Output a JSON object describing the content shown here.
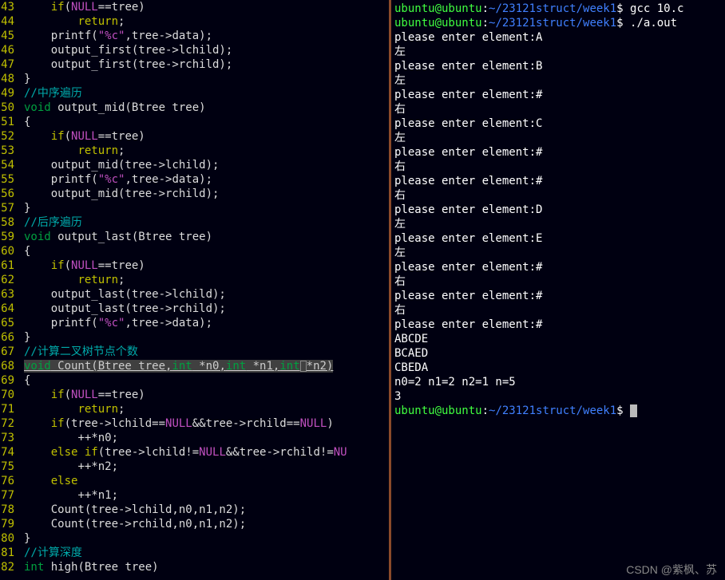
{
  "editor": {
    "lines": [
      {
        "n": 43,
        "html": "    <span class='kw'>if</span><span class='plain'>(</span><span class='const'>NULL</span><span class='plain'>==tree)</span>"
      },
      {
        "n": 44,
        "html": "        <span class='kw'>return</span><span class='plain'>;</span>"
      },
      {
        "n": 45,
        "html": "    <span class='plain'>printf(</span><span class='str'>\"%c\"</span><span class='plain'>,tree-&gt;data);</span>"
      },
      {
        "n": 46,
        "html": "    <span class='plain'>output_first(tree-&gt;lchild);</span>"
      },
      {
        "n": 47,
        "html": "    <span class='plain'>output_first(tree-&gt;rchild);</span>"
      },
      {
        "n": 48,
        "html": "<span class='plain'>}</span>"
      },
      {
        "n": 49,
        "html": "<span class='comment'>//中序遍历</span>"
      },
      {
        "n": 50,
        "html": "<span class='type'>void</span><span class='plain'> output_mid(Btree tree)</span>"
      },
      {
        "n": 51,
        "html": "<span class='plain'>{</span>"
      },
      {
        "n": 52,
        "html": "    <span class='kw'>if</span><span class='plain'>(</span><span class='const'>NULL</span><span class='plain'>==tree)</span>"
      },
      {
        "n": 53,
        "html": "        <span class='kw'>return</span><span class='plain'>;</span>"
      },
      {
        "n": 54,
        "html": "    <span class='plain'>output_mid(tree-&gt;lchild);</span>"
      },
      {
        "n": 55,
        "html": "    <span class='plain'>printf(</span><span class='str'>\"%c\"</span><span class='plain'>,tree-&gt;data);</span>"
      },
      {
        "n": 56,
        "html": "    <span class='plain'>output_mid(tree-&gt;rchild);</span>"
      },
      {
        "n": 57,
        "html": "<span class='plain'>}</span>"
      },
      {
        "n": 58,
        "html": "<span class='comment'>//后序遍历</span>"
      },
      {
        "n": 59,
        "html": "<span class='type'>void</span><span class='plain'> output_last(Btree tree)</span>"
      },
      {
        "n": 60,
        "html": "<span class='plain'>{</span>"
      },
      {
        "n": 61,
        "html": "    <span class='kw'>if</span><span class='plain'>(</span><span class='const'>NULL</span><span class='plain'>==tree)</span>"
      },
      {
        "n": 62,
        "html": "        <span class='kw'>return</span><span class='plain'>;</span>"
      },
      {
        "n": 63,
        "html": "    <span class='plain'>output_last(tree-&gt;lchild);</span>"
      },
      {
        "n": 64,
        "html": "    <span class='plain'>output_last(tree-&gt;rchild);</span>"
      },
      {
        "n": 65,
        "html": "    <span class='plain'>printf(</span><span class='str'>\"%c\"</span><span class='plain'>,tree-&gt;data);</span>"
      },
      {
        "n": 66,
        "html": "<span class='plain'>}</span>"
      },
      {
        "n": 67,
        "html": "<span class='comment'>//计算二叉树节点个数</span>"
      },
      {
        "n": 68,
        "hl": true,
        "html": "<span class='hl'><span class='type'>void</span> Count(Btree tree,<span class='type'>int</span> *n0,<span class='type'>int</span> *n1,<span class='type'>int</span><span class='cursorbox'></span>*n2)</span>"
      },
      {
        "n": 69,
        "html": "<span class='plain'>{</span>"
      },
      {
        "n": 70,
        "html": "    <span class='kw'>if</span><span class='plain'>(</span><span class='const'>NULL</span><span class='plain'>==tree)</span>"
      },
      {
        "n": 71,
        "html": "        <span class='kw'>return</span><span class='plain'>;</span>"
      },
      {
        "n": 72,
        "html": "    <span class='kw'>if</span><span class='plain'>(tree-&gt;lchild==</span><span class='const'>NULL</span><span class='plain'>&amp;&amp;tree-&gt;rchild==</span><span class='const'>NULL</span><span class='plain'>)</span>"
      },
      {
        "n": 73,
        "html": "        <span class='plain'>++*n0;</span>"
      },
      {
        "n": 74,
        "html": "    <span class='kw'>else</span> <span class='kw'>if</span><span class='plain'>(tree-&gt;lchild!=</span><span class='const'>NULL</span><span class='plain'>&amp;&amp;tree-&gt;rchild!=</span><span class='const'>NU</span>"
      },
      {
        "n": 75,
        "html": "        <span class='plain'>++*n2;</span>"
      },
      {
        "n": 76,
        "html": "    <span class='kw'>else</span>"
      },
      {
        "n": 77,
        "html": "        <span class='plain'>++*n1;</span>"
      },
      {
        "n": 78,
        "html": "    <span class='plain'>Count(tree-&gt;lchild,n0,n1,n2);</span>"
      },
      {
        "n": 79,
        "html": "    <span class='plain'>Count(tree-&gt;rchild,n0,n1,n2);</span>"
      },
      {
        "n": 80,
        "html": "<span class='plain'>}</span>"
      },
      {
        "n": 81,
        "html": "<span class='comment'>//计算深度</span>"
      },
      {
        "n": 82,
        "html": "<span class='type'>int</span><span class='plain'> high(Btree tree)</span>"
      }
    ]
  },
  "terminal": {
    "prompt": {
      "user": "ubuntu@ubuntu",
      "path": "~/23121struct/week1",
      "sep": ":",
      "end": "$"
    },
    "entries": [
      {
        "type": "cmd",
        "cmd": "gcc 10.c"
      },
      {
        "type": "cmd",
        "cmd": "./a.out"
      },
      {
        "type": "out",
        "text": "please enter element:A"
      },
      {
        "type": "out",
        "text": "左"
      },
      {
        "type": "out",
        "text": "please enter element:B"
      },
      {
        "type": "out",
        "text": "左"
      },
      {
        "type": "out",
        "text": "please enter element:#"
      },
      {
        "type": "out",
        "text": "右"
      },
      {
        "type": "out",
        "text": "please enter element:C"
      },
      {
        "type": "out",
        "text": "左"
      },
      {
        "type": "out",
        "text": "please enter element:#"
      },
      {
        "type": "out",
        "text": "右"
      },
      {
        "type": "out",
        "text": "please enter element:#"
      },
      {
        "type": "out",
        "text": "右"
      },
      {
        "type": "out",
        "text": "please enter element:D"
      },
      {
        "type": "out",
        "text": "左"
      },
      {
        "type": "out",
        "text": "please enter element:E"
      },
      {
        "type": "out",
        "text": "左"
      },
      {
        "type": "out",
        "text": "please enter element:#"
      },
      {
        "type": "out",
        "text": "右"
      },
      {
        "type": "out",
        "text": "please enter element:#"
      },
      {
        "type": "out",
        "text": "右"
      },
      {
        "type": "out",
        "text": "please enter element:#"
      },
      {
        "type": "out",
        "text": "ABCDE"
      },
      {
        "type": "out",
        "text": "BCAED"
      },
      {
        "type": "out",
        "text": "CBEDA"
      },
      {
        "type": "out",
        "text": "n0=2 n1=2 n2=1 n=5"
      },
      {
        "type": "out",
        "text": "3"
      },
      {
        "type": "prompt-only"
      }
    ]
  },
  "watermark": "CSDN @紫枫、苏"
}
